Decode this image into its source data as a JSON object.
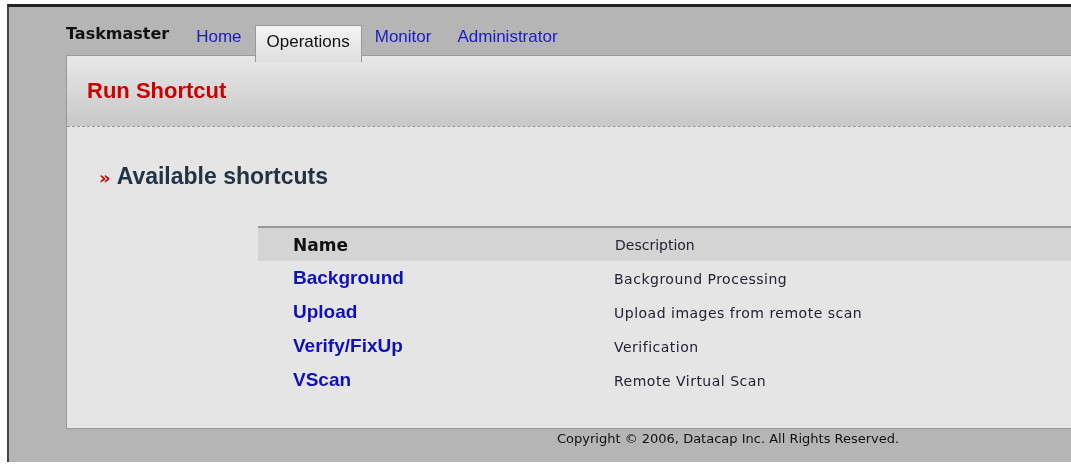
{
  "brand": "Taskmaster",
  "tabs": [
    {
      "label": "Home",
      "selected": false
    },
    {
      "label": "Operations",
      "selected": true
    },
    {
      "label": "Monitor",
      "selected": false
    },
    {
      "label": "Administrator",
      "selected": false
    }
  ],
  "page_title": "Run Shortcut",
  "section": {
    "marker": "»",
    "title": "Available shortcuts"
  },
  "table": {
    "columns": [
      "Name",
      "Description"
    ],
    "rows": [
      {
        "name": "Background",
        "description": "Background Processing"
      },
      {
        "name": "Upload",
        "description": "Upload images from remote scan"
      },
      {
        "name": "Verify/FixUp",
        "description": "Verification"
      },
      {
        "name": "VScan",
        "description": "Remote Virtual Scan"
      }
    ]
  },
  "footer": "Copyright © 2006, Datacap Inc. All Rights Reserved."
}
